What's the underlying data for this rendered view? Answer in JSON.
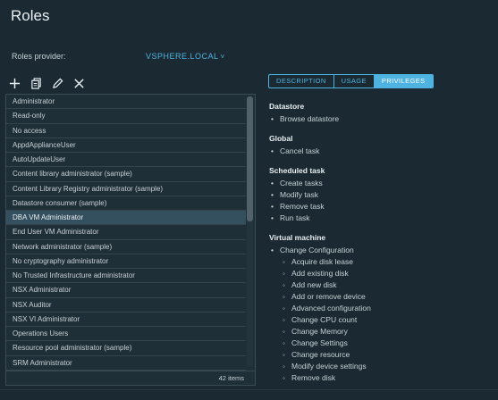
{
  "page": {
    "title": "Roles"
  },
  "provider": {
    "label": "Roles provider:",
    "value": "VSPHERE.LOCAL",
    "chevron": "chevron-down-icon"
  },
  "toolbar": {
    "icons": [
      "add-icon",
      "clone-icon",
      "edit-icon",
      "delete-icon"
    ]
  },
  "roles": {
    "items": [
      "Administrator",
      "Read-only",
      "No access",
      "AppdApplianceUser",
      "AutoUpdateUser",
      "Content library administrator (sample)",
      "Content Library Registry administrator (sample)",
      "Datastore consumer (sample)",
      "DBA VM Administrator",
      "End User VM Administrator",
      "Network administrator (sample)",
      "No cryptography administrator",
      "No Trusted Infrastructure administrator",
      "NSX Administrator",
      "NSX Auditor",
      "NSX VI Administrator",
      "Operations Users",
      "Resource pool administrator (sample)",
      "SRM Administrator"
    ],
    "selected": "DBA VM Administrator",
    "count": "42 items"
  },
  "tabs": [
    {
      "label": "DESCRIPTION",
      "active": false
    },
    {
      "label": "USAGE",
      "active": false
    },
    {
      "label": "PRIVILEGES",
      "active": true
    }
  ],
  "privileges": {
    "datastore": {
      "title": "Datastore",
      "items": [
        "Browse datastore"
      ]
    },
    "global": {
      "title": "Global",
      "items": [
        "Cancel task"
      ]
    },
    "scheduled": {
      "title": "Scheduled task",
      "items": [
        "Create tasks",
        "Modify task",
        "Remove task",
        "Run task"
      ]
    },
    "vm": {
      "title": "Virtual machine",
      "item": "Change Configuration",
      "subitems": [
        "Acquire disk lease",
        "Add existing disk",
        "Add new disk",
        "Add or remove device",
        "Advanced configuration",
        "Change CPU count",
        "Change Memory",
        "Change Settings",
        "Change resource",
        "Modify device settings",
        "Remove disk"
      ]
    }
  },
  "colors": {
    "background": "#1b2a32",
    "accent": "#4eb3e0",
    "selected_row": "#34505f"
  }
}
